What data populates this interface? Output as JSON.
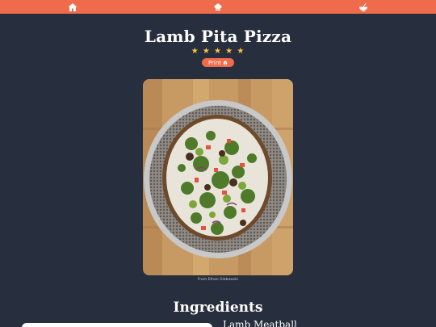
{
  "nav": {
    "items": [
      {
        "icon": "home-icon"
      },
      {
        "icon": "chef-hat-icon"
      },
      {
        "icon": "mixing-bowl-icon"
      }
    ],
    "color": "#ef6b4b"
  },
  "recipe": {
    "title": "Lamb Pita Pizza",
    "rating": 5,
    "stars": [
      "★",
      "★",
      "★",
      "★",
      "★"
    ],
    "print_label": "Print",
    "photo_credit": "From Ethan Glebowski"
  },
  "ingredients": {
    "heading": "Ingredients",
    "subsection": "Lamb Meatball"
  },
  "colors": {
    "background": "#272e3d",
    "accent": "#ef6b4b",
    "star": "#f6c443"
  }
}
